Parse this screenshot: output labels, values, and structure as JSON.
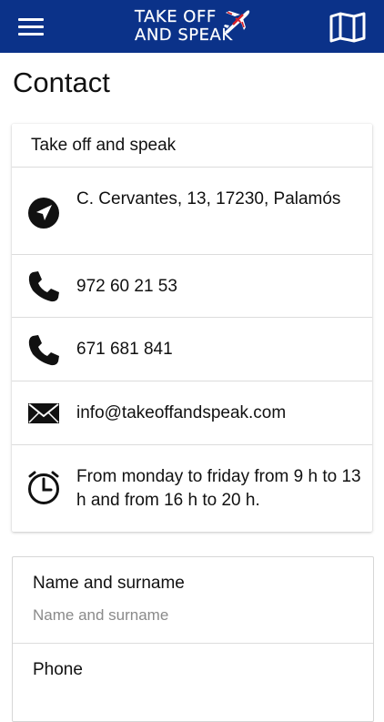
{
  "header": {
    "logo_line1": "TAKE OFF",
    "logo_line2": "AND SPEAK",
    "menu_icon": "hamburger-menu-icon",
    "map_icon": "folded-map-icon",
    "bg_color": "#0b3289"
  },
  "page": {
    "title": "Contact"
  },
  "contact_card": {
    "title": "Take off and speak",
    "rows": [
      {
        "icon": "navigation-arrow-icon",
        "text": "C. Cervantes, 13, 17230, Palamós"
      },
      {
        "icon": "phone-icon",
        "text": "972 60 21 53"
      },
      {
        "icon": "phone-icon",
        "text": "671 681 841"
      },
      {
        "icon": "envelope-icon",
        "text": "info@takeoffandspeak.com"
      },
      {
        "icon": "clock-icon",
        "text": "From monday to friday from 9 h to 13 h and from 16 h to 20 h."
      }
    ]
  },
  "form": {
    "name_label": "Name and surname",
    "name_placeholder": "Name and surname",
    "phone_label": "Phone"
  }
}
